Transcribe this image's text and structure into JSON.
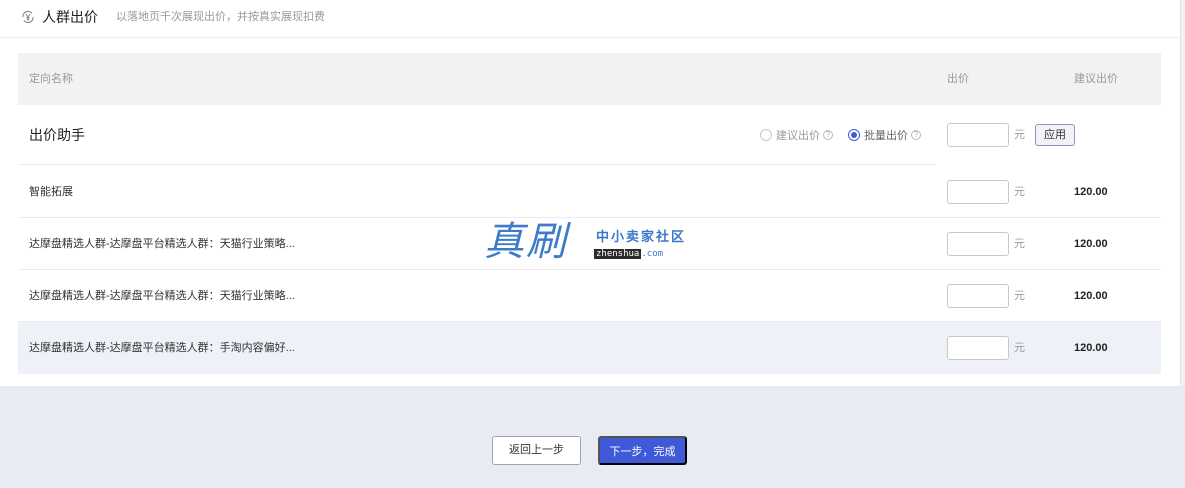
{
  "header": {
    "title": "人群出价",
    "subtitle": "以落地页千次展现出价，并按真实展现扣费",
    "icon": "yen-refresh-icon"
  },
  "table": {
    "headers": {
      "name": "定向名称",
      "bid": "出价",
      "suggested": "建议出价"
    },
    "unit": "元",
    "helper": {
      "title": "出价助手",
      "options": [
        {
          "label": "建议出价",
          "checked": false
        },
        {
          "label": "批量出价",
          "checked": true
        }
      ],
      "help_mark": "?",
      "apply_label": "应用"
    },
    "rows": [
      {
        "name": "智能拓展",
        "bid": "",
        "suggested": "120.00"
      },
      {
        "name": "达摩盘精选人群-达摩盘平台精选人群：天猫行业策略...",
        "bid": "",
        "suggested": "120.00"
      },
      {
        "name": "达摩盘精选人群-达摩盘平台精选人群：天猫行业策略...",
        "bid": "",
        "suggested": "120.00"
      },
      {
        "name": "达摩盘精选人群-达摩盘平台精选人群：手淘内容偏好...",
        "bid": "",
        "suggested": "120.00"
      }
    ]
  },
  "watermark": {
    "big": "真刷",
    "cn": "中小卖家社区",
    "url_main": "zhenshua",
    "url_tld": ".com"
  },
  "footer": {
    "back_label": "返回上一步",
    "next_label": "下一步，完成"
  },
  "colors": {
    "accent": "#3f59d9",
    "highlight_row": "#eef1f8",
    "page_bg": "#e9ebf2"
  }
}
